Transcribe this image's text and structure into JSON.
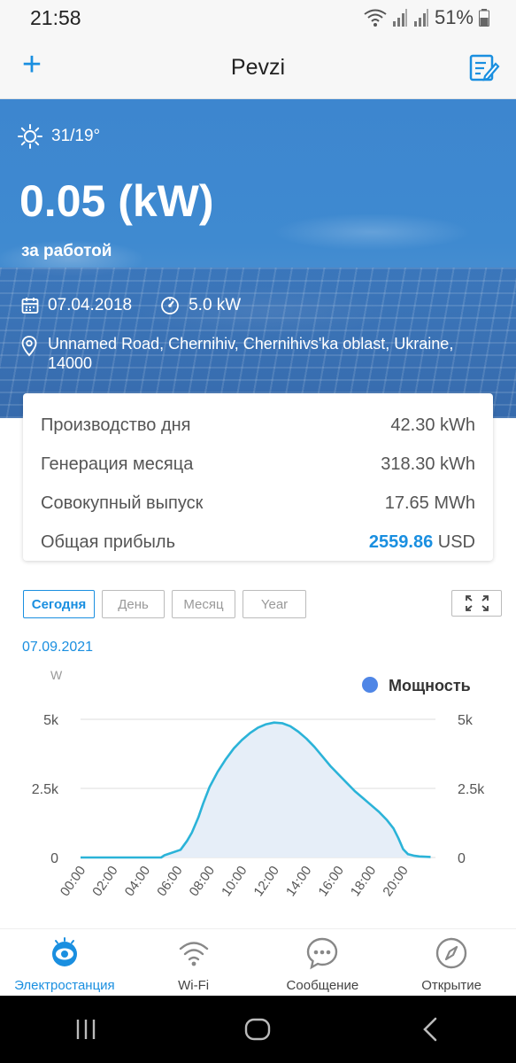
{
  "status_bar": {
    "time": "21:58",
    "battery": "51%"
  },
  "app_bar": {
    "title": "Pevzi",
    "add_label": "+"
  },
  "hero": {
    "weather": "31/19°",
    "power": "0.05 (kW)",
    "power_status": "за работой",
    "date": "07.04.2018",
    "capacity": "5.0 kW",
    "address": "Unnamed Road, Chernihiv, Chernihivs'ka oblast, Ukraine, 14000"
  },
  "stats": [
    {
      "label": "Производство дня",
      "value": "42.30 kWh"
    },
    {
      "label": "Генерация месяца",
      "value": "318.30 kWh"
    },
    {
      "label": "Совокупный выпуск",
      "value": "17.65 MWh"
    },
    {
      "label": "Общая прибыль",
      "profit": "2559.86",
      "currency": " USD"
    }
  ],
  "tabs": [
    "Сегодня",
    "День",
    "Месяц",
    "Year"
  ],
  "chart_date": "07.09.2021",
  "chart_data": {
    "type": "area",
    "ylabel": "W",
    "legend": "Мощность",
    "legend_position": "top-right",
    "ylim": [
      0,
      5000
    ],
    "yticks": [
      "0",
      "2.5k",
      "5k"
    ],
    "xticks": [
      "00:00",
      "02:00",
      "04:00",
      "06:00",
      "08:00",
      "10:00",
      "12:00",
      "14:00",
      "16:00",
      "18:00",
      "20:00"
    ],
    "color": "#2bb3d8",
    "fill": "#e6eef8",
    "x": [
      0,
      5,
      5.2,
      6.2,
      6.6,
      6.9,
      7.3,
      7.6,
      8.0,
      8.5,
      9.0,
      9.5,
      10.0,
      10.5,
      11.0,
      11.5,
      12.0,
      12.5,
      13.0,
      13.5,
      14.0,
      14.5,
      15.0,
      15.5,
      16.0,
      16.5,
      17.0,
      17.5,
      18.0,
      18.5,
      19.0,
      19.4,
      19.7,
      20.0,
      20.3,
      20.7,
      21.0,
      21.7
    ],
    "y": [
      0,
      0,
      80,
      280,
      600,
      900,
      1450,
      1950,
      2550,
      3100,
      3550,
      3950,
      4250,
      4500,
      4700,
      4820,
      4880,
      4860,
      4750,
      4550,
      4300,
      4000,
      3650,
      3300,
      3000,
      2700,
      2400,
      2150,
      1900,
      1650,
      1350,
      1050,
      700,
      300,
      120,
      60,
      40,
      20
    ]
  },
  "bottom_nav": [
    {
      "label": "Электростанция",
      "icon": "eye-icon",
      "active": true
    },
    {
      "label": "Wi-Fi",
      "icon": "wifi-icon",
      "active": false
    },
    {
      "label": "Сообщение",
      "icon": "chat-icon",
      "active": false
    },
    {
      "label": "Открытие",
      "icon": "compass-icon",
      "active": false
    }
  ],
  "colors": {
    "accent": "#1a8fe0",
    "chart_line": "#2bb3d8"
  }
}
